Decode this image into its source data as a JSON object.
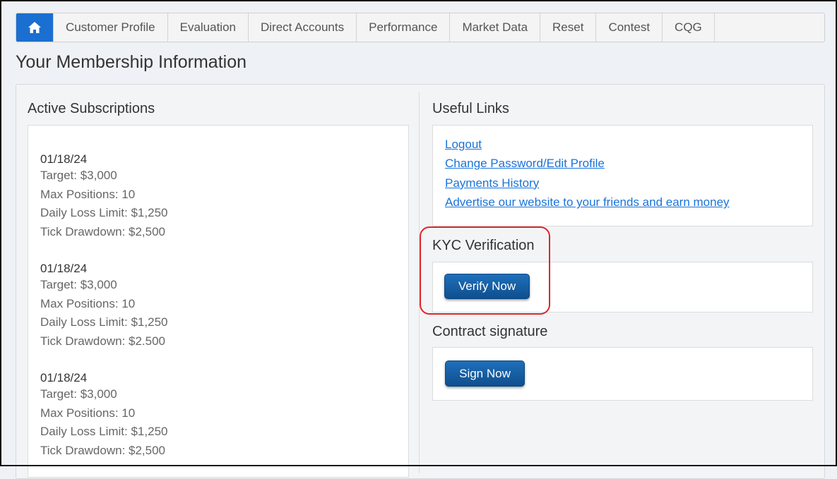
{
  "nav": {
    "home_icon": "home-icon",
    "tabs": [
      "Customer Profile",
      "Evaluation",
      "Direct Accounts",
      "Performance",
      "Market Data",
      "Reset",
      "Contest",
      "CQG"
    ]
  },
  "page_title": "Your Membership Information",
  "subscriptions": {
    "title": "Active Subscriptions",
    "items": [
      {
        "date": "01/18/24",
        "target": "Target: $3,000",
        "max_positions": "Max Positions: 10",
        "daily_loss": "Daily Loss Limit: $1,250",
        "tick_drawdown": "Tick Drawdown: $2,500"
      },
      {
        "date": "01/18/24",
        "target": "Target: $3,000",
        "max_positions": "Max Positions: 10",
        "daily_loss": "Daily Loss Limit: $1,250",
        "tick_drawdown": "Tick Drawdown: $2.500"
      },
      {
        "date": "01/18/24",
        "target": "Target: $3,000",
        "max_positions": "Max Positions: 10",
        "daily_loss": "Daily Loss Limit: $1,250",
        "tick_drawdown": "Tick Drawdown: $2,500"
      }
    ]
  },
  "useful_links": {
    "title": "Useful Links",
    "links": [
      "Logout",
      "Change Password/Edit Profile",
      "Payments History",
      "Advertise our website to your friends and earn money"
    ]
  },
  "kyc": {
    "title": "KYC Verification",
    "button": "Verify Now"
  },
  "contract": {
    "title": "Contract signature",
    "button": "Sign Now"
  },
  "colors": {
    "accent": "#1a6fd0",
    "link": "#1a73d9",
    "highlight": "#e0252b"
  }
}
